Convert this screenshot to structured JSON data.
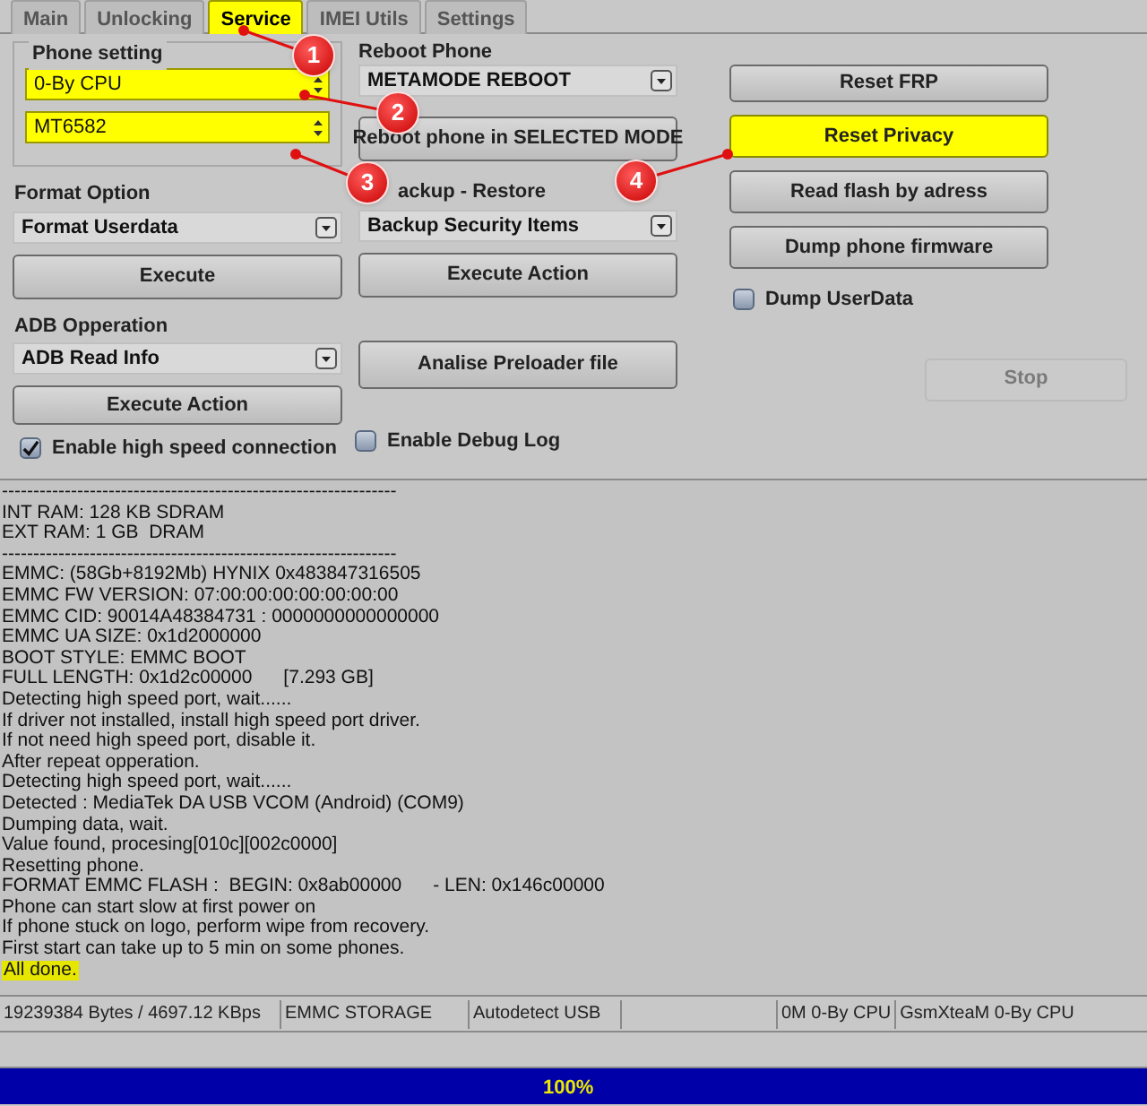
{
  "tabs": [
    {
      "label": "Main",
      "selected": false,
      "highlighted": false
    },
    {
      "label": "Unlocking",
      "selected": false,
      "highlighted": false
    },
    {
      "label": "Service",
      "selected": true,
      "highlighted": true
    },
    {
      "label": "IMEI Utils",
      "selected": false,
      "highlighted": false
    },
    {
      "label": "Settings",
      "selected": false,
      "highlighted": false
    }
  ],
  "phone_setting": {
    "title": "Phone setting",
    "combos": [
      {
        "value": "0-By CPU",
        "highlighted": true
      },
      {
        "value": "MT6582",
        "highlighted": true
      }
    ]
  },
  "format_option": {
    "label": "Format Option",
    "value": "Format Userdata",
    "button": "Execute"
  },
  "adb_operation": {
    "label": "ADB Opperation",
    "value": "ADB Read Info",
    "button": "Execute Action"
  },
  "reboot_phone": {
    "label": "Reboot Phone",
    "value": "METAMODE REBOOT",
    "button": "Reboot phone in SELECTED MODE"
  },
  "backup_restore": {
    "label": "ackup - Restore",
    "value": "Backup Security Items",
    "button": "Execute Action"
  },
  "analise_button": "Analise Preloader file",
  "actions": [
    {
      "label": "Reset FRP",
      "highlighted": false
    },
    {
      "label": "Reset Privacy",
      "highlighted": true
    },
    {
      "label": "Read flash by adress",
      "highlighted": false
    },
    {
      "label": "Dump phone firmware",
      "highlighted": false
    }
  ],
  "dump_userdata": {
    "label": "Dump UserData",
    "checked": false
  },
  "stop_button": {
    "label": "Stop",
    "disabled": true
  },
  "options": [
    {
      "label": "Enable high speed connection",
      "checked": true
    },
    {
      "label": "Enable Debug Log",
      "checked": false
    }
  ],
  "annotations": [
    "1",
    "2",
    "3",
    "4"
  ],
  "log": [
    {
      "text": "---------------------------------------------------------------",
      "highlighted": false
    },
    {
      "text": "INT RAM: 128 KB SDRAM",
      "highlighted": false
    },
    {
      "text": "EXT RAM: 1 GB  DRAM",
      "highlighted": false
    },
    {
      "text": "---------------------------------------------------------------",
      "highlighted": false
    },
    {
      "text": "EMMC: (58Gb+8192Mb) HYNIX 0x483847316505",
      "highlighted": false
    },
    {
      "text": "EMMC FW VERSION: 07:00:00:00:00:00:00:00",
      "highlighted": false
    },
    {
      "text": "EMMC CID: 90014A48384731 : 0000000000000000",
      "highlighted": false
    },
    {
      "text": "EMMC UA SIZE: 0x1d2000000",
      "highlighted": false
    },
    {
      "text": "BOOT STYLE: EMMC BOOT",
      "highlighted": false
    },
    {
      "text": "FULL LENGTH: 0x1d2c00000      [7.293 GB]",
      "highlighted": false
    },
    {
      "text": "Detecting high speed port, wait......",
      "highlighted": false
    },
    {
      "text": "If driver not installed, install high speed port driver.",
      "highlighted": false
    },
    {
      "text": "If not need high speed port, disable it.",
      "highlighted": false
    },
    {
      "text": "After repeat opperation.",
      "highlighted": false
    },
    {
      "text": "Detecting high speed port, wait......",
      "highlighted": false
    },
    {
      "text": "Detected : MediaTek DA USB VCOM (Android) (COM9)",
      "highlighted": false
    },
    {
      "text": "Dumping data, wait.",
      "highlighted": false
    },
    {
      "text": "Value found, procesing[010c][002c0000]",
      "highlighted": false
    },
    {
      "text": "Resetting phone.",
      "highlighted": false
    },
    {
      "text": "FORMAT EMMC FLASH :  BEGIN: 0x8ab00000      - LEN: 0x146c00000",
      "highlighted": false
    },
    {
      "text": "Phone can start slow at first power on",
      "highlighted": false
    },
    {
      "text": "If phone stuck on logo, perform wipe from recovery.",
      "highlighted": false
    },
    {
      "text": "First start can take up to 5 min on some phones.",
      "highlighted": false
    },
    {
      "text": "All done.",
      "highlighted": true
    }
  ],
  "status_bar": [
    "19239384 Bytes / 4697.12 KBps",
    "EMMC STORAGE",
    "Autodetect USB",
    "0M 0-By CPU",
    "GsmXteaM 0-By CPU"
  ],
  "progress": {
    "level": 1,
    "reading": "100%"
  }
}
